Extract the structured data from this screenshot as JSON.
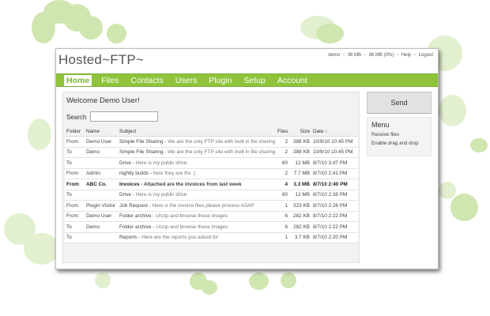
{
  "app": {
    "logo": "Hosted~FTP~"
  },
  "top_links": {
    "user": "demo",
    "quota": "36 MB",
    "usage": "36 MB (0%)",
    "help": "Help",
    "logout": "Logout",
    "separator": "~"
  },
  "nav": {
    "items": [
      {
        "label": "Home",
        "active": true
      },
      {
        "label": "Files"
      },
      {
        "label": "Contacts"
      },
      {
        "label": "Users"
      },
      {
        "label": "Plugin"
      },
      {
        "label": "Setup"
      },
      {
        "label": "Account"
      }
    ]
  },
  "main": {
    "welcome": "Welcome Demo User!",
    "search_label": "Search",
    "search_value": "",
    "columns": [
      "Folder",
      "Name",
      "Subject",
      "Files",
      "Size",
      "Date ↓"
    ],
    "rows": [
      {
        "folder": "From",
        "name": "Demo User",
        "subject": "Simple File Sharing",
        "desc": "We are the only FTP site with built in file sharing !",
        "files": "2",
        "size": "388 KB",
        "date": "10/9/10 10:45 PM",
        "bold": false
      },
      {
        "folder": "To",
        "name": "Demo",
        "subject": "Simple File Sharing",
        "desc": "We are the only FTP site with built in file sharing !",
        "files": "2",
        "size": "388 KB",
        "date": "10/9/10 10:45 PM",
        "bold": false
      },
      {
        "folder": "To",
        "name": "",
        "subject": "Drive",
        "desc": "Here is my public drive",
        "files": "80",
        "size": "12 MB",
        "date": "8/7/10 3:47 PM",
        "bold": false
      },
      {
        "folder": "From",
        "name": "Admin",
        "subject": "nightly builds",
        "desc": "here they are thx :)",
        "files": "2",
        "size": "7.7 MB",
        "date": "8/7/10 2:41 PM",
        "bold": false
      },
      {
        "folder": "From",
        "name": "ABC Co.",
        "subject": "Invoices",
        "desc": "Attached are the invoices from last week",
        "files": "4",
        "size": "3.3 MB",
        "date": "8/7/10 2:40 PM",
        "bold": true
      },
      {
        "folder": "To",
        "name": "",
        "subject": "Drive",
        "desc": "Here is my public drive",
        "files": "80",
        "size": "12 MB",
        "date": "8/7/10 2:38 PM",
        "bold": false
      },
      {
        "folder": "From",
        "name": "Plugin Visitor",
        "subject": "Job Request",
        "desc": "Here is the invoice files please process ASAP",
        "files": "1",
        "size": "323 KB",
        "date": "8/7/10 2:26 PM",
        "bold": false
      },
      {
        "folder": "From",
        "name": "Demo User",
        "subject": "Folder archive",
        "desc": "Unzip and browse these images",
        "files": "6",
        "size": "282 KB",
        "date": "8/7/10 2:22 PM",
        "bold": false
      },
      {
        "folder": "To",
        "name": "Demo",
        "subject": "Folder archive",
        "desc": "Unzip and browse these images",
        "files": "6",
        "size": "282 KB",
        "date": "8/7/10 2:22 PM",
        "bold": false
      },
      {
        "folder": "To",
        "name": "",
        "subject": "Reports",
        "desc": "Here are the reports you asked for",
        "files": "1",
        "size": "3.7 KB",
        "date": "8/7/10 2:20 PM",
        "bold": false
      }
    ]
  },
  "sidebar": {
    "send_label": "Send",
    "menu_title": "Menu",
    "menu_items": [
      "Receive files",
      "Enable drag and drop"
    ]
  },
  "colors": {
    "brand_green": "#8fc33c",
    "clover": "#cfe6b0"
  }
}
